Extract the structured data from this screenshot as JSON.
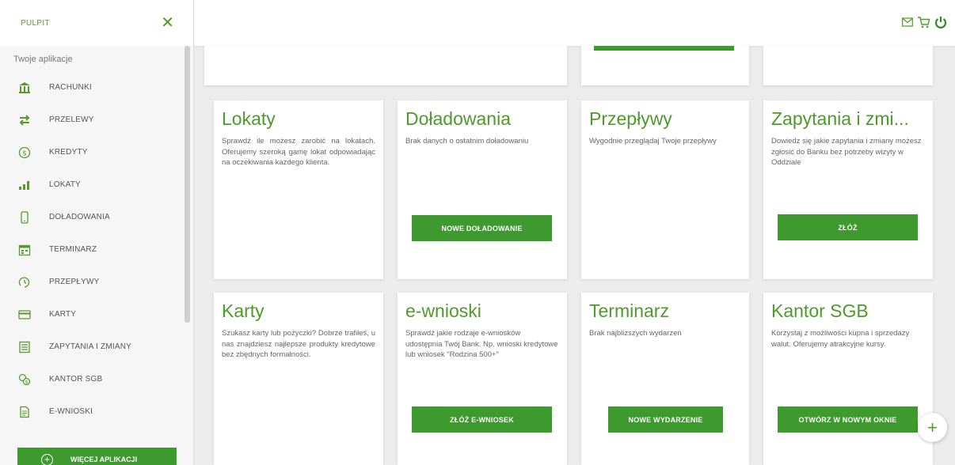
{
  "sidebar": {
    "title": "PULPIT",
    "subtitle": "Twoje aplikacje",
    "items": [
      {
        "label": "RACHUNKI",
        "icon": "bank-icon"
      },
      {
        "label": "PRZELEWY",
        "icon": "transfer-arrows-icon"
      },
      {
        "label": "KREDYTY",
        "icon": "dollar-coin-icon"
      },
      {
        "label": "LOKATY",
        "icon": "bars-growth-icon"
      },
      {
        "label": "DOŁADOWANIA",
        "icon": "phone-icon"
      },
      {
        "label": "TERMINARZ",
        "icon": "calendar-icon"
      },
      {
        "label": "PRZEPŁYWY",
        "icon": "clock-flow-icon"
      },
      {
        "label": "KARTY",
        "icon": "card-icon"
      },
      {
        "label": "ZAPYTANIA I ZMIANY",
        "icon": "list-doc-icon"
      },
      {
        "label": "KANTOR SGB",
        "icon": "exchange-icon"
      },
      {
        "label": "E-WNIOSKI",
        "icon": "document-icon"
      }
    ],
    "more_label": "WIĘCEJ APLIKACJI"
  },
  "cards": {
    "lokaty": {
      "title": "Lokaty",
      "text": "Sprawdź ile możesz zarobić na lokatach. Oferujemy szeroką gamę lokat odpowiadając na oczekiwania każdego klienta."
    },
    "doladowania": {
      "title": "Doładowania",
      "text": "Brak danych o ostatnim doładowaniu",
      "button": "NOWE DOŁADOWANIE"
    },
    "przeplywy": {
      "title": "Przepływy",
      "text": "Wygodnie przeglądaj Twoje przepływy"
    },
    "zapytania": {
      "title": "Zapytania i zmi...",
      "text": "Dowiedz się jakie zapytania i zmiany możesz zgłosić do Banku bez potrzeby wizyty w Oddziale",
      "button": "ZŁÓŻ"
    },
    "karty": {
      "title": "Karty",
      "text": "Szukasz karty lub pożyczki? Dobrze trafiłeś, u nas znajdziesz najlepsze produkty kredytowe bez zbędnych formalności."
    },
    "ewnioski": {
      "title": "e-wnioski",
      "text": "Sprawdź jakie rodzaje e-wniosków udostępnia Twój Bank. Np. wnioski kredytowe lub wniosek \"Rodzina 500+\"",
      "button": "ZŁÓŻ E-WNIOSEK"
    },
    "terminarz": {
      "title": "Terminarz",
      "text": "Brak najbliższych wydarzeń",
      "button": "NOWE WYDARZENIE"
    },
    "kantor": {
      "title": "Kantor SGB",
      "text": "Korzystaj z możliwości kupna i sprzedaży walut. Oferujemy atrakcyjne kursy.",
      "button": "OTWÓRZ W NOWYM OKNIE"
    }
  },
  "fab_label": "+",
  "colors": {
    "accent": "#3e9a2e",
    "title_green": "#4e9a2a"
  }
}
